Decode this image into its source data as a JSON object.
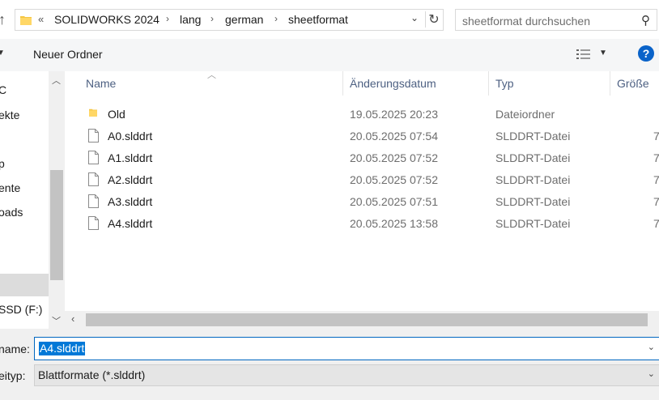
{
  "breadcrumb": {
    "overflow": "«",
    "parts": [
      "SOLIDWORKS 2024",
      "lang",
      "german",
      "sheetformat"
    ]
  },
  "search": {
    "placeholder": "sheetformat durchsuchen"
  },
  "toolbar": {
    "new_folder": "Neuer Ordner",
    "help": "?"
  },
  "nav": {
    "items": [
      "C",
      "ekte",
      "",
      "p",
      "ente",
      "oads",
      "",
      "",
      "SSD (F:)"
    ]
  },
  "columns": {
    "name": "Name",
    "date": "Änderungsdatum",
    "type": "Typ",
    "size": "Größe"
  },
  "files": [
    {
      "name": "Old",
      "date": "19.05.2025 20:23",
      "type": "Dateiordner",
      "size": "",
      "kind": "folder"
    },
    {
      "name": "A0.slddrt",
      "date": "20.05.2025 07:54",
      "type": "SLDDRT-Datei",
      "size": "7",
      "kind": "file"
    },
    {
      "name": "A1.slddrt",
      "date": "20.05.2025 07:52",
      "type": "SLDDRT-Datei",
      "size": "7",
      "kind": "file"
    },
    {
      "name": "A2.slddrt",
      "date": "20.05.2025 07:52",
      "type": "SLDDRT-Datei",
      "size": "7",
      "kind": "file"
    },
    {
      "name": "A3.slddrt",
      "date": "20.05.2025 07:51",
      "type": "SLDDRT-Datei",
      "size": "7",
      "kind": "file"
    },
    {
      "name": "A4.slddrt",
      "date": "20.05.2025 13:58",
      "type": "SLDDRT-Datei",
      "size": "7",
      "kind": "file"
    }
  ],
  "filename": {
    "label": "name:",
    "value": "A4.slddrt"
  },
  "filetype": {
    "label": "eityp:",
    "value": "Blattformate (*.slddrt)"
  },
  "colors": {
    "accent": "#0078d7",
    "folder": "#f4c542",
    "help": "#0a63c9"
  }
}
